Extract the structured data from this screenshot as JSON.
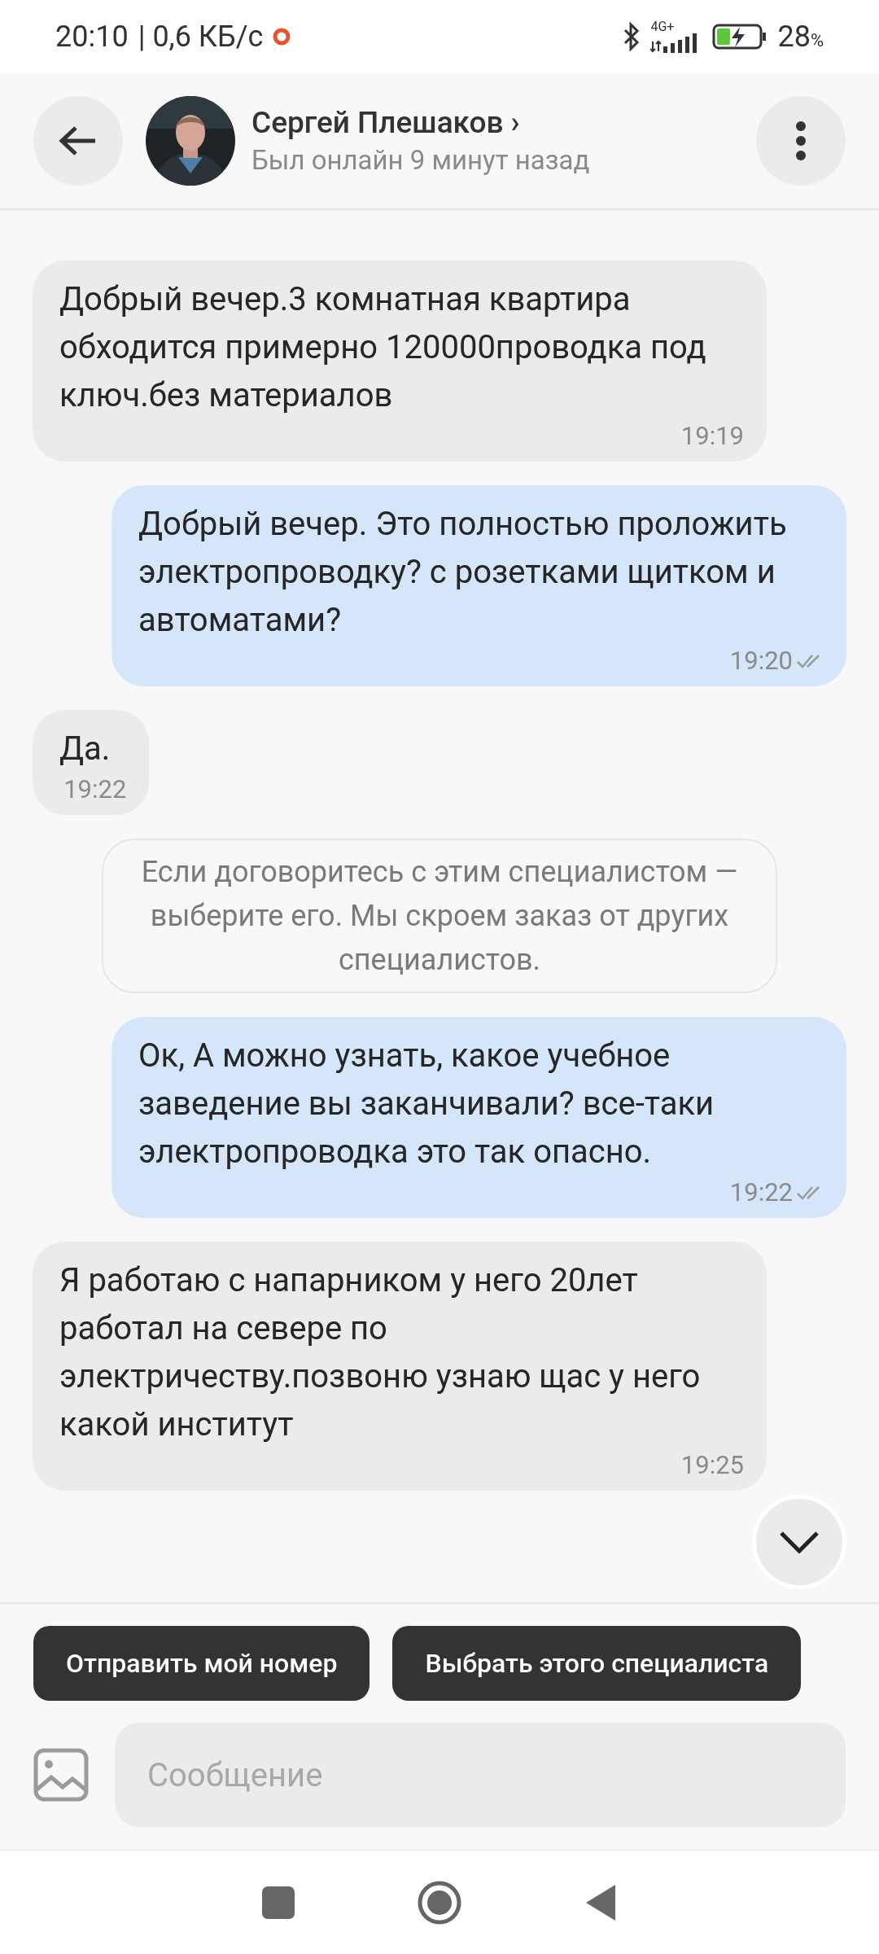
{
  "status_bar": {
    "time": "20:10",
    "speed": "| 0,6 КБ/с",
    "network": "4G+",
    "battery": "28",
    "battery_unit": "%"
  },
  "header": {
    "name": "Сергей Плешаков ›",
    "status": "Был онлайн 9 минут назад"
  },
  "messages": [
    {
      "kind": "incoming",
      "text": "Добрый вечер.3 комнатная квартира обходится примерно 120000проводка под ключ.без материалов",
      "time": "19:19"
    },
    {
      "kind": "outgoing",
      "text": "Добрый вечер. Это полностью проложить электропроводку? с розетками щитком и автоматами?",
      "time": "19:20",
      "read": true
    },
    {
      "kind": "incoming",
      "text": "Да.",
      "time": "19:22"
    },
    {
      "kind": "notice",
      "text": "Если договоритесь с этим специалистом — выберите его. Мы скроем заказ от других специалистов."
    },
    {
      "kind": "outgoing",
      "text": "Ок, А можно узнать, какое учебное заведение вы заканчивали? все-таки электропроводка это так опасно.",
      "time": "19:22",
      "read": true
    },
    {
      "kind": "incoming",
      "text": "Я работаю с напарником у него 20лет работал на севере  по электричеству.позвоню узнаю щас у него какой институт",
      "time": "19:25"
    }
  ],
  "actions": [
    "Отправить мой номер",
    "Выбрать этого специалиста"
  ],
  "composer": {
    "placeholder": "Сообщение"
  }
}
